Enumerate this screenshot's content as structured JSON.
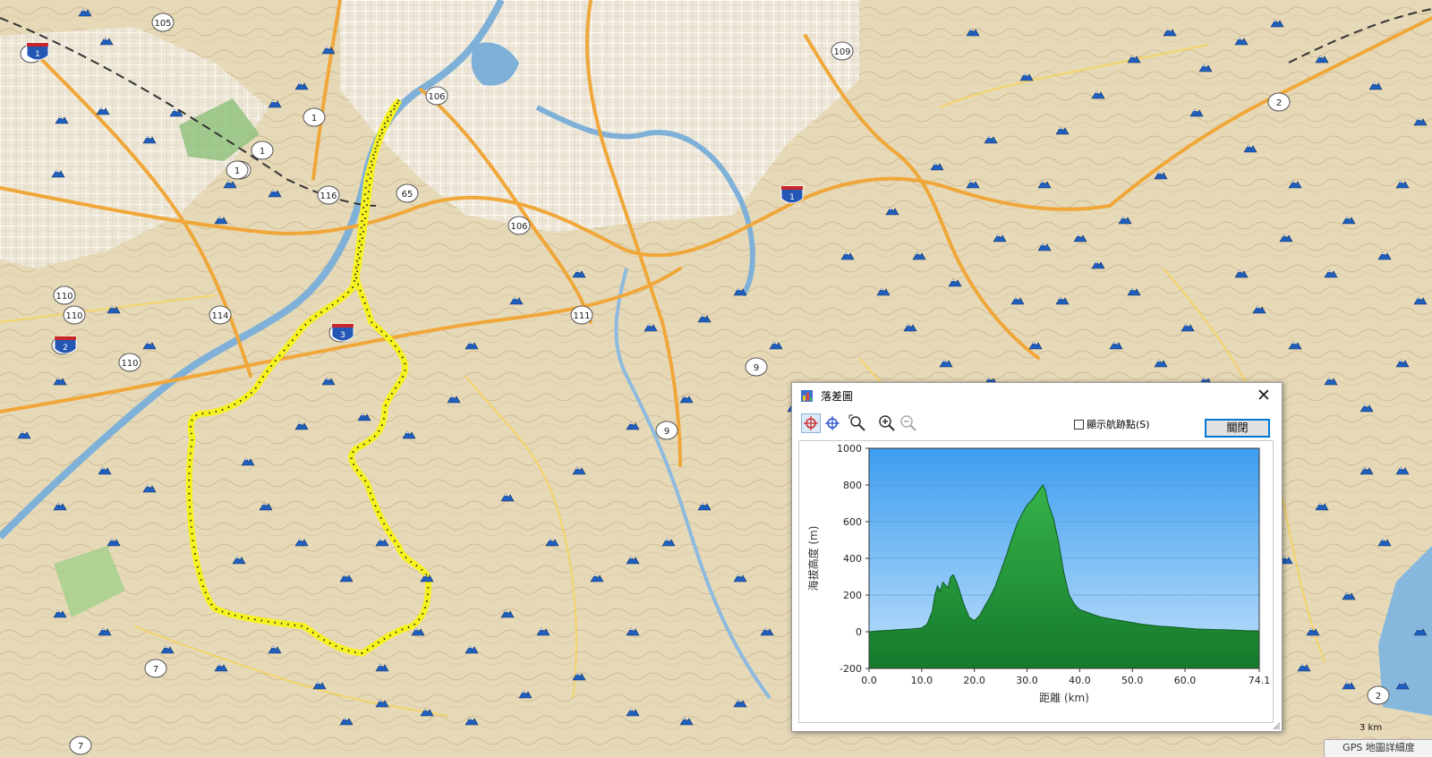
{
  "map": {
    "route_shields": [
      "105",
      "1",
      "1",
      "1",
      "1",
      "116",
      "65",
      "106",
      "106",
      "110",
      "110",
      "110",
      "114",
      "111",
      "9",
      "9",
      "2",
      "2",
      "7",
      "7",
      "109",
      "3",
      "2",
      "1"
    ],
    "interstate_shields": [
      "1",
      "3",
      "2",
      "1"
    ],
    "scale_label": "3 km",
    "status_label": "GPS 地圖詳細度",
    "colors": {
      "terrain": "#e8ddc0",
      "major_road": "#f0a73a",
      "minor_road": "#f3d36a",
      "track": "#f5ef2a",
      "water": "#7fb1d8",
      "peak_marker": "#1f5fbf",
      "park": "#8cc07a"
    }
  },
  "dialog": {
    "title": "落差圖",
    "close_glyph": "✕",
    "toolbar": {
      "icons": [
        "crosshair-red-icon",
        "crosshair-blue-icon",
        "zoom-select-icon",
        "zoom-in-icon",
        "zoom-out-icon"
      ]
    },
    "checkbox_label": "顯示航跡點(S)",
    "checkbox_checked": false,
    "close_button_label": "關閉"
  },
  "chart_data": {
    "type": "area",
    "title": "",
    "xlabel": "距離 (km)",
    "ylabel": "海拔高度 (m)",
    "xlim": [
      0,
      74.1
    ],
    "ylim": [
      -200,
      1000
    ],
    "x_ticks": [
      "0.0",
      "10.0",
      "20.0",
      "30.0",
      "40.0",
      "50.0",
      "60.0",
      "74.1"
    ],
    "y_ticks": [
      "-200",
      "0",
      "200",
      "400",
      "600",
      "800",
      "1000"
    ],
    "grid": true,
    "colors": {
      "sky_top": "#3d9ef0",
      "sky_bottom": "#bfe0fb",
      "fill_top": "#36b24a",
      "fill_bottom": "#157a2c"
    },
    "series": [
      {
        "x": [
          0,
          2,
          4,
          6,
          8,
          10,
          11,
          12,
          12.5,
          13,
          13.5,
          14,
          15,
          15.5,
          16,
          16.5,
          17,
          18,
          19,
          20,
          21,
          22,
          23,
          24,
          25,
          26,
          27,
          28,
          29,
          30,
          31,
          32,
          33,
          33.5,
          34,
          35,
          36,
          37,
          38,
          39,
          40,
          41,
          42,
          43,
          44,
          46,
          48,
          50,
          52,
          55,
          58,
          60,
          62,
          65,
          68,
          70,
          72,
          74.1
        ],
        "y": [
          0,
          5,
          8,
          12,
          15,
          20,
          40,
          110,
          200,
          250,
          220,
          270,
          240,
          300,
          310,
          280,
          240,
          150,
          80,
          60,
          90,
          140,
          190,
          250,
          330,
          410,
          500,
          580,
          640,
          690,
          720,
          760,
          800,
          770,
          700,
          620,
          490,
          320,
          200,
          150,
          120,
          110,
          100,
          90,
          80,
          70,
          60,
          50,
          40,
          30,
          25,
          20,
          15,
          12,
          10,
          8,
          5,
          5
        ]
      }
    ]
  }
}
